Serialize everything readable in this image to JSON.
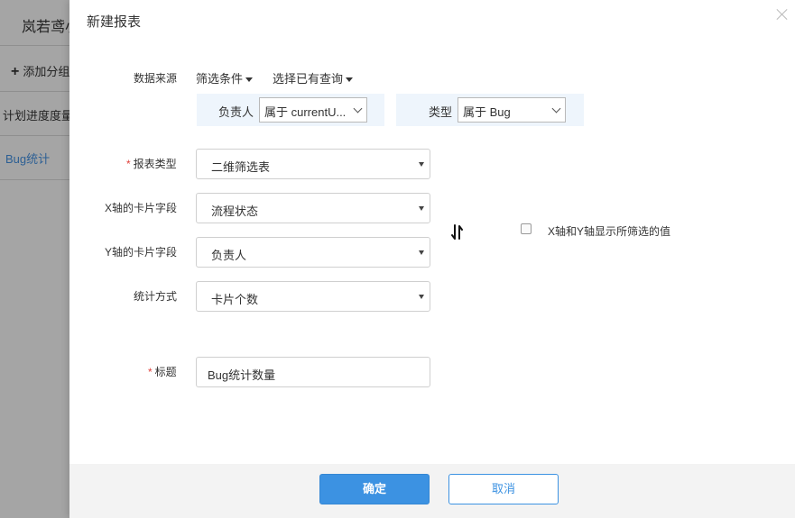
{
  "background": {
    "title": "岚若鸢小",
    "add_group": "添加分组",
    "items": [
      "计划进度度量",
      "Bug统计"
    ]
  },
  "modal": {
    "title": "新建报表",
    "data_source": {
      "label": "数据来源",
      "filter_conditions": "筛选条件",
      "select_saved_query": "选择已有查询",
      "conditions": [
        {
          "label": "负责人",
          "value": "属于 currentU..."
        },
        {
          "label": "类型",
          "value": "属于 Bug"
        }
      ]
    },
    "report_type": {
      "label": "报表类型",
      "value": "二维筛选表"
    },
    "x_field": {
      "label": "X轴的卡片字段",
      "value": "流程状态"
    },
    "y_field": {
      "label": "Y轴的卡片字段",
      "value": "负责人"
    },
    "stat_method": {
      "label": "统计方式",
      "value": "卡片个数"
    },
    "show_filtered_label": "X轴和Y轴显示所筛选的值",
    "title_field": {
      "label": "标题",
      "value": "Bug统计数量"
    },
    "required_mark": "*",
    "confirm": "确定",
    "cancel": "取消"
  },
  "colors": {
    "primary": "#3c92e2",
    "required": "#e0413b",
    "condition_bg": "#eef5fc"
  }
}
